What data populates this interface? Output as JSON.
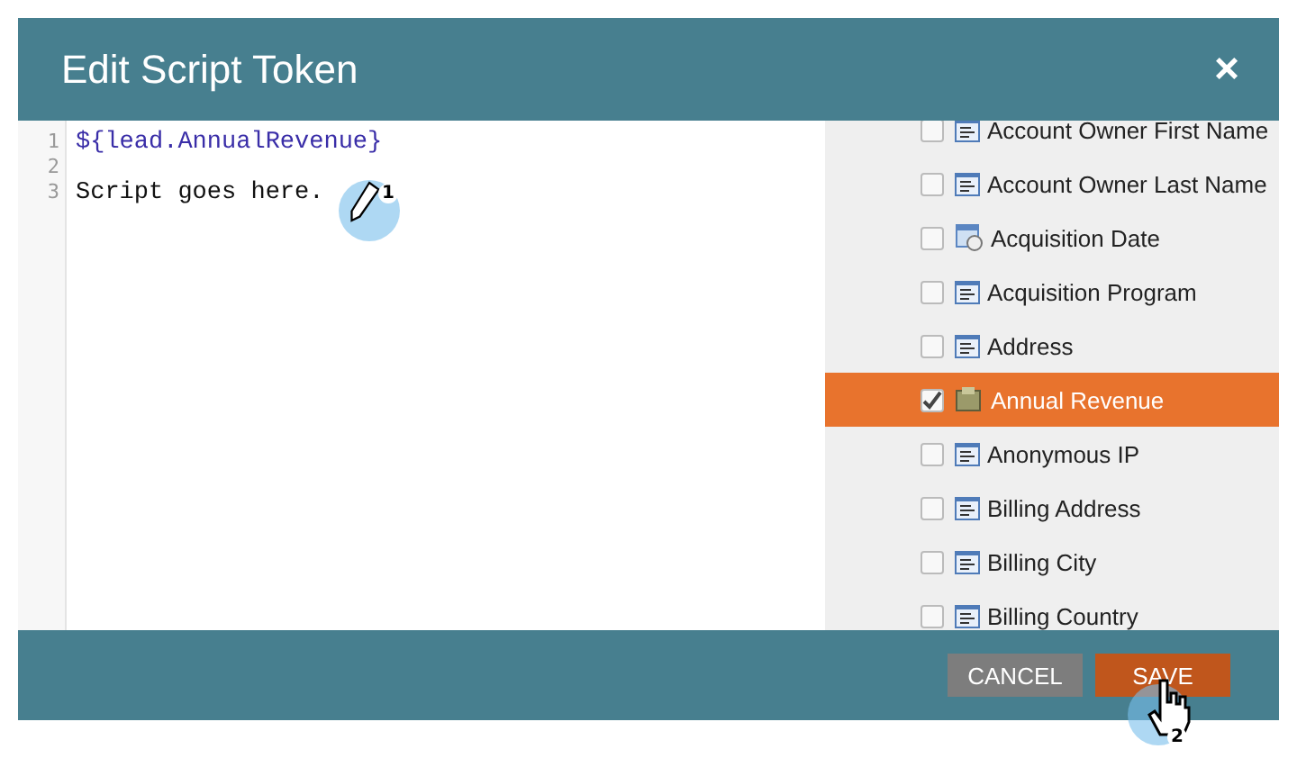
{
  "window": {
    "title": "Edit Script Token",
    "close": "×"
  },
  "editor": {
    "lines": [
      {
        "number": "1",
        "text": "${lead.AnnualRevenue}",
        "kind": "token"
      },
      {
        "number": "2",
        "kind": "plain"
      },
      {
        "number": "3",
        "text": "Script goes here.",
        "kind": "plain"
      }
    ]
  },
  "fields": [
    {
      "label": "Account Owner First Name",
      "kind": "text",
      "checked": false,
      "selected": false
    },
    {
      "label": "Account Owner Last Name",
      "kind": "text",
      "checked": false,
      "selected": false
    },
    {
      "label": "Acquisition Date",
      "kind": "date",
      "checked": false,
      "selected": false
    },
    {
      "label": "Acquisition Program",
      "kind": "text",
      "checked": false,
      "selected": false
    },
    {
      "label": "Address",
      "kind": "text",
      "checked": false,
      "selected": false
    },
    {
      "label": "Annual Revenue",
      "kind": "currency",
      "checked": true,
      "selected": true
    },
    {
      "label": "Anonymous IP",
      "kind": "text",
      "checked": false,
      "selected": false
    },
    {
      "label": "Billing Address",
      "kind": "text",
      "checked": false,
      "selected": false
    },
    {
      "label": "Billing City",
      "kind": "text",
      "checked": false,
      "selected": false
    },
    {
      "label": "Billing Country",
      "kind": "text",
      "checked": false,
      "selected": false
    }
  ],
  "buttons": [
    {
      "label": "CANCEL",
      "kind": "secondary"
    },
    {
      "label": "SAVE",
      "kind": "primary"
    }
  ],
  "steps": [
    {
      "number": "1",
      "kind": "pencil"
    },
    {
      "number": "2",
      "kind": "hand"
    }
  ]
}
